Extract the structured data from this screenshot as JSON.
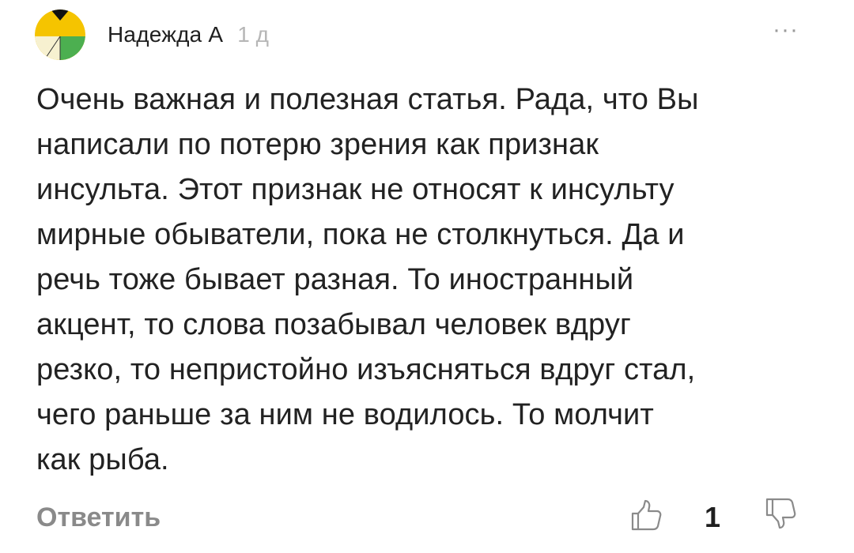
{
  "comment": {
    "author": "Надежда А",
    "time": "1 д",
    "more_label": "···",
    "text": "Очень важная и полезная статья. Рада, что Вы\nнаписали по потерю зрения как признак\nинсульта. Этот признак не относят к инсульту\nмирные обыватели, пока не столкнуться.  Да и\nречь тоже бывает разная. То иностранный\nакцент, то слова позабывал человек вдруг\nрезко, то непристойно изъясняться вдруг стал,\nчего раньше за ним не водилось. То молчит\nкак рыба.",
    "reply_label": "Ответить",
    "like_count": "1"
  },
  "icons": {
    "avatar": "avatar-icon",
    "like": "thumb-up-icon",
    "dislike": "thumb-down-icon",
    "more": "more-dots-icon"
  },
  "colors": {
    "avatar_yellow": "#f5c400",
    "avatar_green": "#4caf50",
    "avatar_cream": "#f7f1d0",
    "avatar_black": "#111111",
    "muted_text": "#8a8a8a"
  }
}
